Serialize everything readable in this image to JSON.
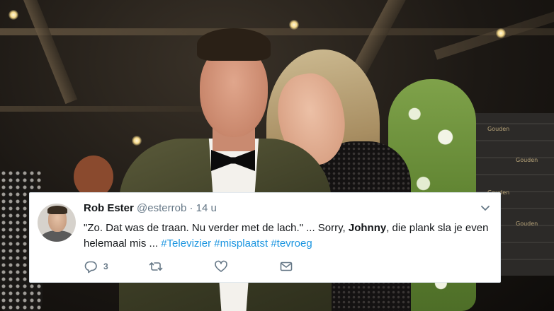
{
  "background": {
    "wall_logo": "Gouden"
  },
  "tweet": {
    "display_name": "Rob Ester",
    "handle": "@esterrob",
    "separator": "·",
    "time": "14 u",
    "text_part1": "\"Zo. Dat was de traan. Nu verder met de lach.\" ... Sorry, ",
    "mention_bold": "Johnny",
    "text_part2": ", die plank sla je even helemaal mis ... ",
    "hashtags": [
      "#Televizier",
      "#misplaatst",
      "#tevroeg"
    ],
    "reply_count": "3",
    "retweet_count": "",
    "like_count": "",
    "icons": {
      "reply": "reply-icon",
      "retweet": "retweet-icon",
      "like": "heart-icon",
      "dm": "envelope-icon",
      "menu": "chevron-down-icon"
    },
    "colors": {
      "text": "#14171a",
      "muted": "#657786",
      "link": "#1b95e0"
    }
  }
}
